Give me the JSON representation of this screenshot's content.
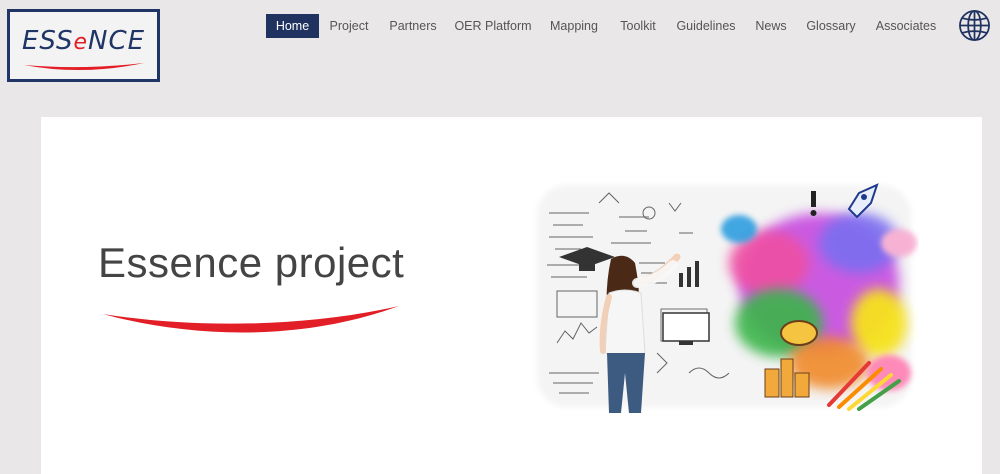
{
  "logo": {
    "text_before": "ESS",
    "text_accent": "e",
    "text_after": "NCE",
    "border_color": "#1e3566",
    "accent_color": "#e21f26"
  },
  "nav": {
    "active_color": "#1f3260",
    "items": [
      {
        "label": "Home",
        "active": true
      },
      {
        "label": "Project",
        "active": false
      },
      {
        "label": "Partners",
        "active": false
      },
      {
        "label": "OER Platform",
        "active": false
      },
      {
        "label": "Mapping",
        "active": false
      },
      {
        "label": "Toolkit",
        "active": false
      },
      {
        "label": "Guidelines",
        "active": false
      },
      {
        "label": "News",
        "active": false
      },
      {
        "label": "Glossary",
        "active": false
      },
      {
        "label": "Associates",
        "active": false
      }
    ]
  },
  "language_switch": {
    "icon": "globe-icon"
  },
  "hero": {
    "title": "Essence project",
    "underline_color": "#e21f26"
  }
}
